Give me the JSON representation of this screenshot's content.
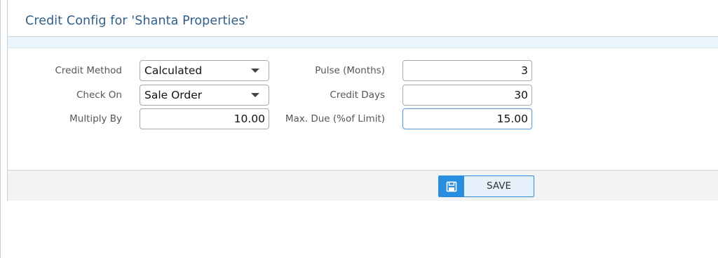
{
  "dialog": {
    "title": "Credit Config for 'Shanta Properties'"
  },
  "form": {
    "credit_method": {
      "label": "Credit Method",
      "value": "Calculated"
    },
    "check_on": {
      "label": "Check On",
      "value": "Sale Order"
    },
    "multiply_by": {
      "label": "Multiply By",
      "value": "10.00"
    },
    "pulse_months": {
      "label": "Pulse (Months)",
      "value": "3"
    },
    "credit_days": {
      "label": "Credit Days",
      "value": "30"
    },
    "max_due": {
      "label": "Max. Due (%of Limit)",
      "value": "15.00"
    }
  },
  "footer": {
    "save_label": "SAVE"
  },
  "colors": {
    "title": "#2f5f8a",
    "accent": "#2a8ee0",
    "strip": "#eaf6fc"
  }
}
